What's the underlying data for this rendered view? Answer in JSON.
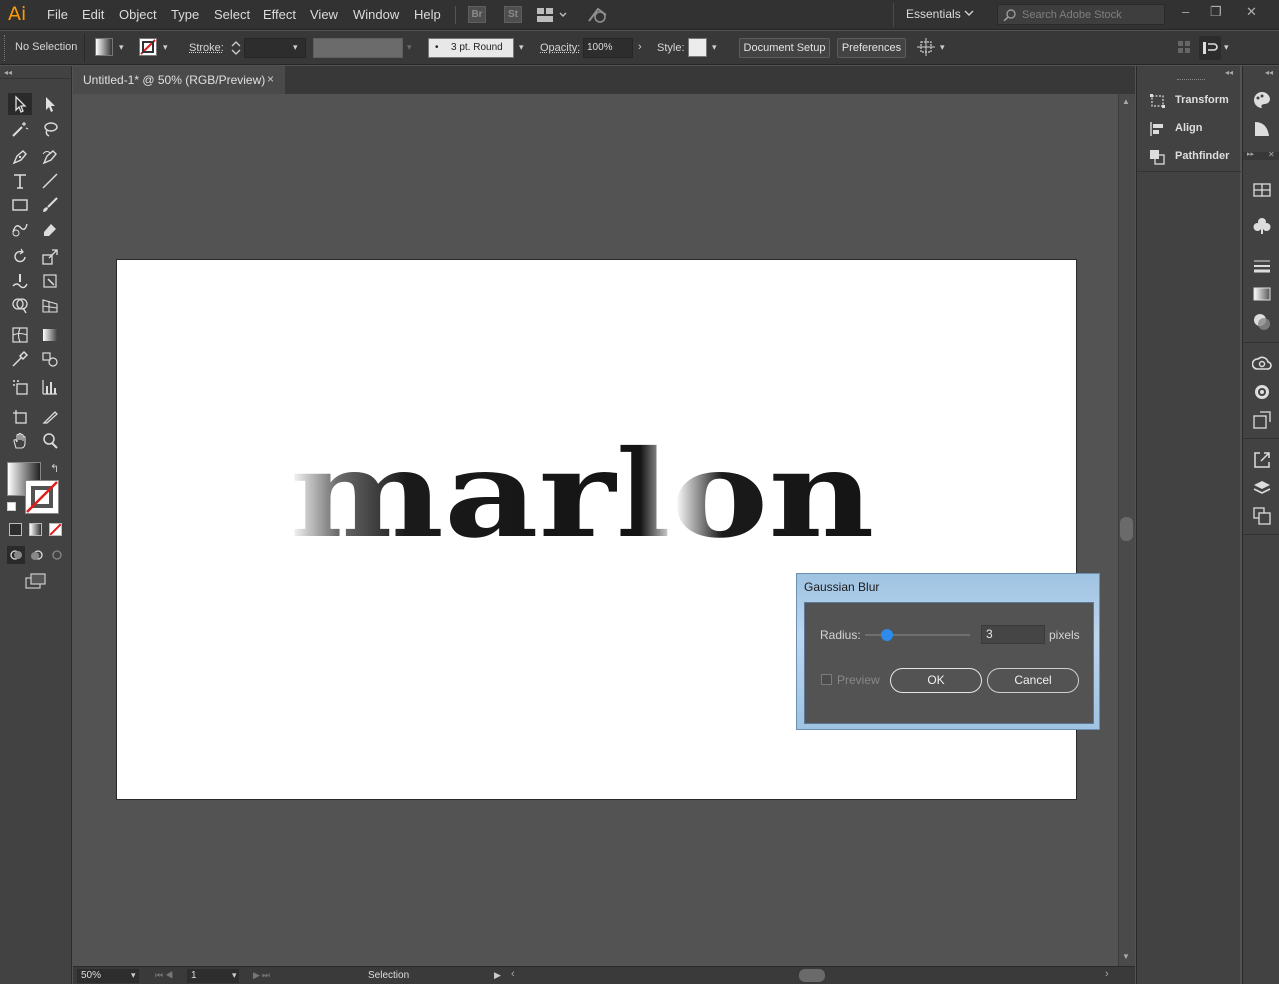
{
  "app": {
    "logo": "Ai"
  },
  "menu": [
    "File",
    "Edit",
    "Object",
    "Type",
    "Select",
    "Effect",
    "View",
    "Window",
    "Help"
  ],
  "app_badges": {
    "bridge": "Br",
    "stock": "St"
  },
  "workspace": "Essentials",
  "search": {
    "placeholder": "Search Adobe Stock"
  },
  "control_bar": {
    "selection": "No Selection",
    "stroke_label": "Stroke:",
    "brush": "3 pt. Round",
    "opacity_label": "Opacity:",
    "opacity": "100%",
    "style_label": "Style:",
    "document_setup": "Document Setup",
    "preferences": "Preferences"
  },
  "document_tab": {
    "title": "Untitled-1* @ 50% (RGB/Preview)",
    "close": "×"
  },
  "artboard": {
    "text": "marlon"
  },
  "status_bar": {
    "zoom": "50%",
    "page": "1",
    "tool": "Selection"
  },
  "dialog": {
    "title": "Gaussian Blur",
    "radius_label": "Radius:",
    "radius_value": "3",
    "radius_slider": 0.17,
    "unit": "pixels",
    "preview_label": "Preview",
    "preview_checked": false,
    "ok": "OK",
    "cancel": "Cancel"
  },
  "panels": [
    "Transform",
    "Align",
    "Pathfinder"
  ],
  "side_icons": [
    "color-icon",
    "color-guide-icon",
    "swatches-icon",
    "symbols-icon",
    "stroke-icon",
    "gradient-icon",
    "transparency-icon",
    "creative-cloud-libraries-icon",
    "appearance-icon",
    "graphic-styles-icon",
    "export-icon",
    "layers-icon",
    "artboards-icon"
  ],
  "colors": {
    "chrome": "#323232",
    "panel": "#424242",
    "canvas": "#535353",
    "accent": "#ff9a00",
    "slider": "#2d8ceb"
  }
}
